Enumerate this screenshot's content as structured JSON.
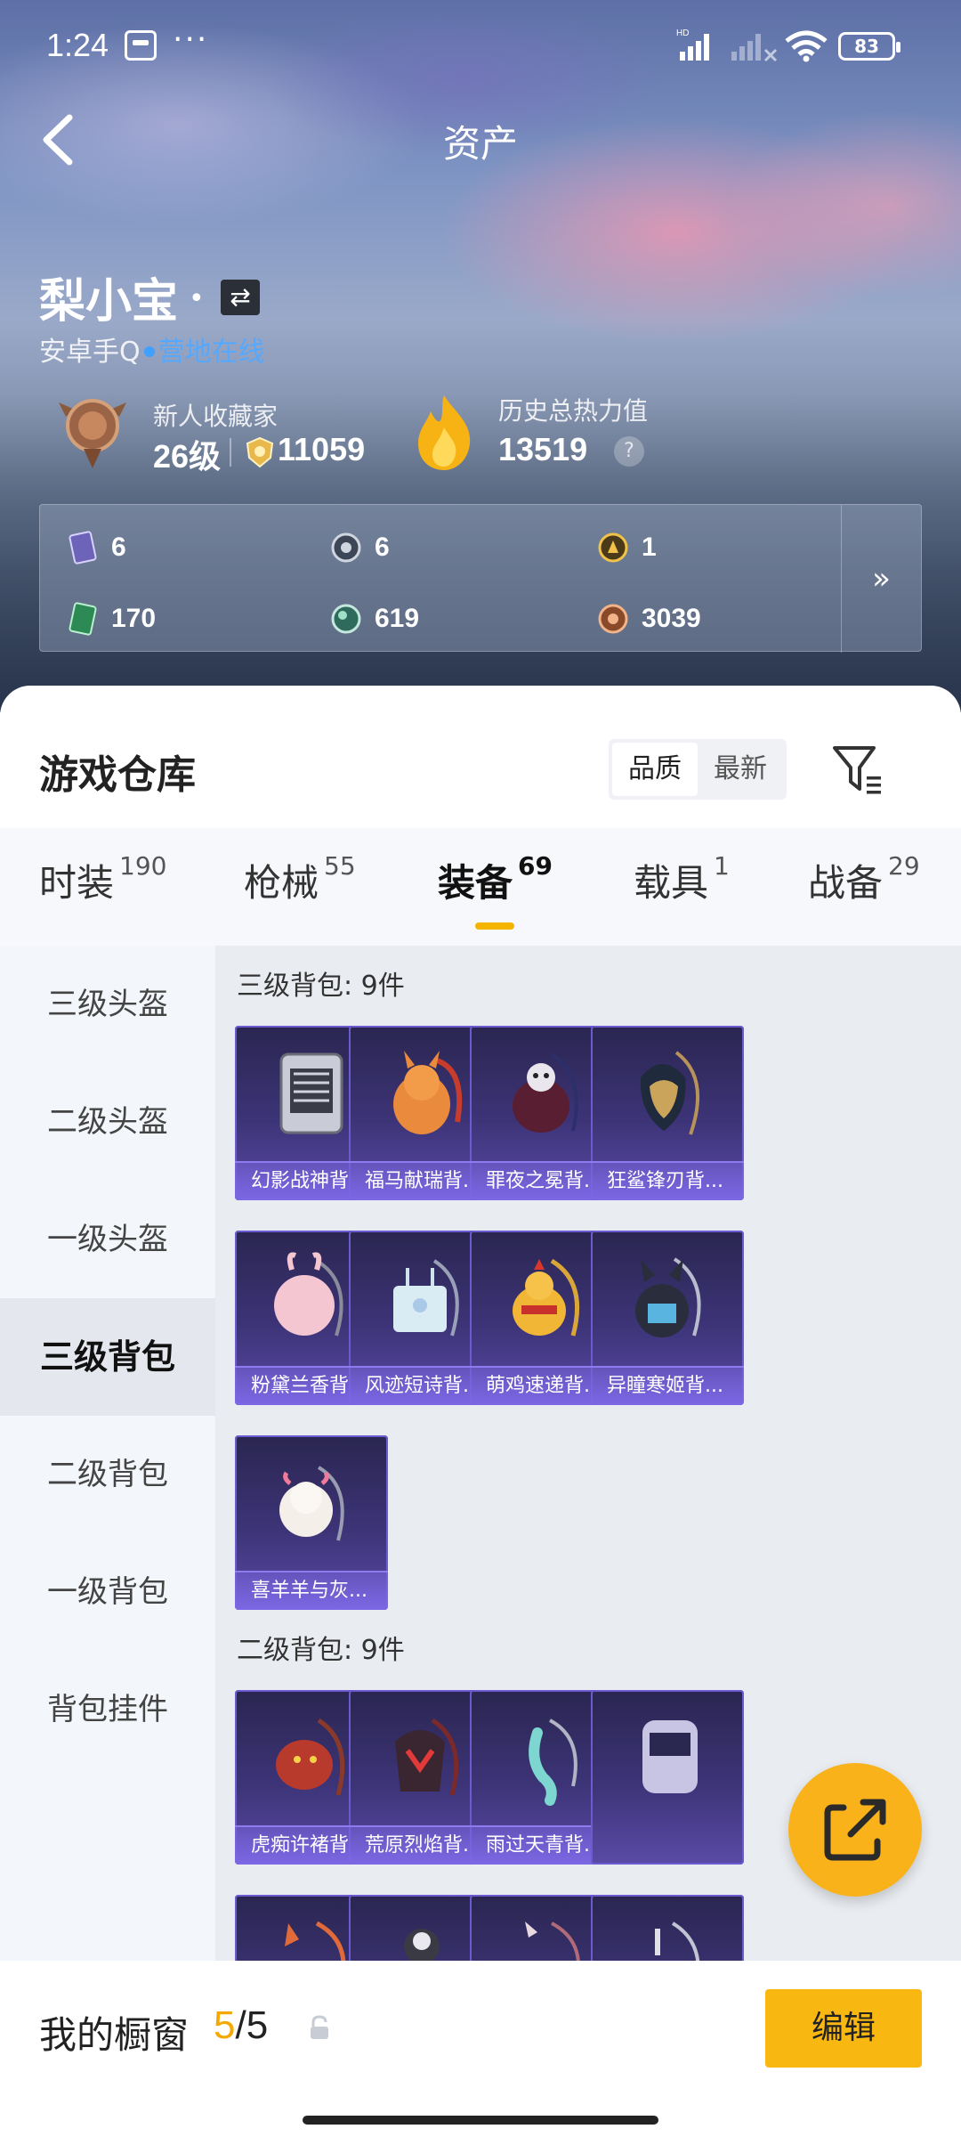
{
  "status_bar": {
    "time": "1:24",
    "battery": "83",
    "dots": "···"
  },
  "header": {
    "title": "资产",
    "back_icon": "chevron-left-icon"
  },
  "profile": {
    "name": "梨小宝",
    "name_dot": "•",
    "platform": "安卓手Q",
    "online_status": "营地在线",
    "rank_title": "新人收藏家",
    "level": "26级",
    "coins": "11059",
    "heat_title": "历史总热力值",
    "heat_value": "13519",
    "help": "?"
  },
  "assets": [
    {
      "icon": "card-icon",
      "value": "6"
    },
    {
      "icon": "gear-badge-icon",
      "value": "6"
    },
    {
      "icon": "gold-badge-icon",
      "value": "1"
    },
    {
      "icon": "ticket-icon",
      "value": "170"
    },
    {
      "icon": "orb-icon",
      "value": "619"
    },
    {
      "icon": "bronze-coin-icon",
      "value": "3039"
    }
  ],
  "assets_more": "»",
  "warehouse": {
    "title": "游戏仓库",
    "sort_options": [
      "品质",
      "最新"
    ],
    "active_sort": "品质"
  },
  "tabs": [
    {
      "label": "时装",
      "count": "190"
    },
    {
      "label": "枪械",
      "count": "55"
    },
    {
      "label": "装备",
      "count": "69"
    },
    {
      "label": "载具",
      "count": "1"
    },
    {
      "label": "战备",
      "count": "29"
    }
  ],
  "active_tab": "装备",
  "side_items": [
    "三级头盔",
    "二级头盔",
    "一级头盔",
    "三级背包",
    "二级背包",
    "一级背包",
    "背包挂件"
  ],
  "active_side_item": "三级背包",
  "sections": [
    {
      "title": "三级背包: 9件",
      "items": [
        "幻影战神背...",
        "福马献瑞背...",
        "罪夜之冕背...",
        "狂鲨锋刃背...",
        "粉黛兰香背...",
        "风迹短诗背...",
        "萌鸡速递背...",
        "异瞳寒姬背...",
        "喜羊羊与灰..."
      ]
    },
    {
      "title": "二级背包: 9件",
      "items": [
        "虎痴许褚背...",
        "荒原烈焰背...",
        "雨过天青背...",
        "",
        "",
        "",
        "",
        ""
      ]
    }
  ],
  "showcase": {
    "label": "我的橱窗",
    "current": "5",
    "total": "/5"
  },
  "edit_label": "编辑",
  "colors": {
    "accent": "#f9b712",
    "online": "#3fa0ff",
    "card_purple": "#3d3478"
  }
}
